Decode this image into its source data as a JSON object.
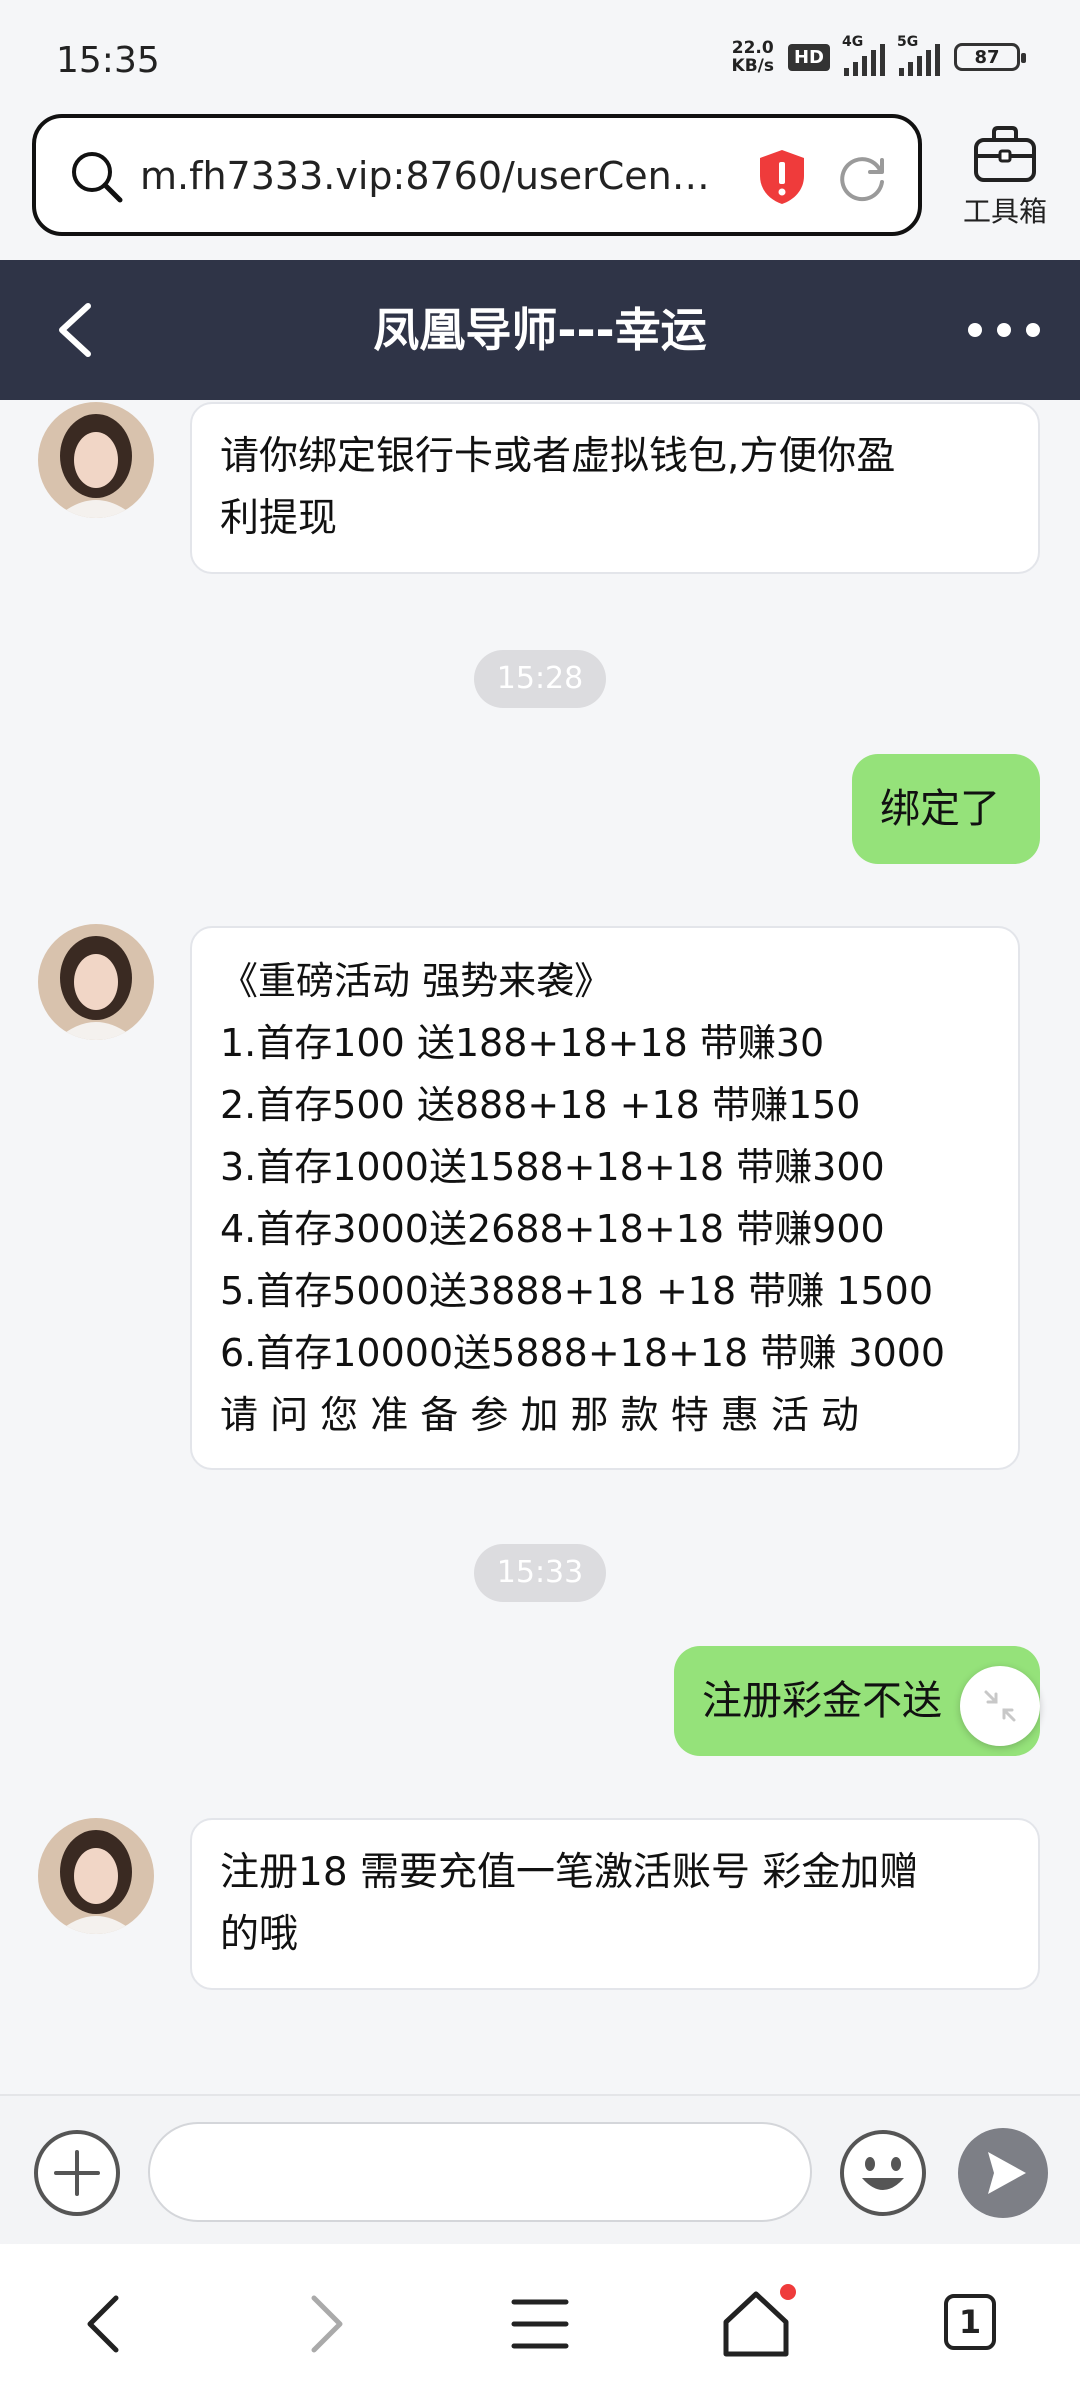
{
  "status_bar": {
    "time": "15:35",
    "net_speed_value": "22.0",
    "net_speed_unit": "KB/s",
    "hd_label": "HD",
    "signal1_label": "4G",
    "signal2_label": "5G",
    "battery": "87"
  },
  "browser": {
    "url": "m.fh7333.vip:8760/userCent…",
    "toolbox_label": "工具箱"
  },
  "chat": {
    "title": "凤凰导师---幸运"
  },
  "messages": {
    "m1_lines": [
      "请你绑定银行卡或者虚拟钱包,方便你盈",
      "利提现"
    ],
    "time1": "15:28",
    "m2": "绑定了",
    "m3_lines": [
      "《重磅活动 强势来袭》",
      "1.首存100 送188+18+18 带赚30",
      "2.首存500 送888+18 +18 带赚150",
      "3.首存1000送1588+18+18 带赚300",
      "4.首存3000送2688+18+18 带赚900",
      "5.首存5000送3888+18 +18 带赚 1500",
      "6.首存10000送5888+18+18 带赚 3000",
      "请 问 您 准 备 参 加 那 款 特 惠 活 动"
    ],
    "time2": "15:33",
    "m4": "注册彩金不送",
    "m5_lines": [
      "注册18 需要充值一笔激活账号 彩金加赠",
      "的哦"
    ]
  },
  "input": {
    "value": "",
    "placeholder": ""
  },
  "bottom_nav": {
    "tab_count": "1"
  },
  "colors": {
    "header_bg": "#2f3447",
    "my_bubble": "#95e27a",
    "alert_red": "#ef3b3b"
  }
}
